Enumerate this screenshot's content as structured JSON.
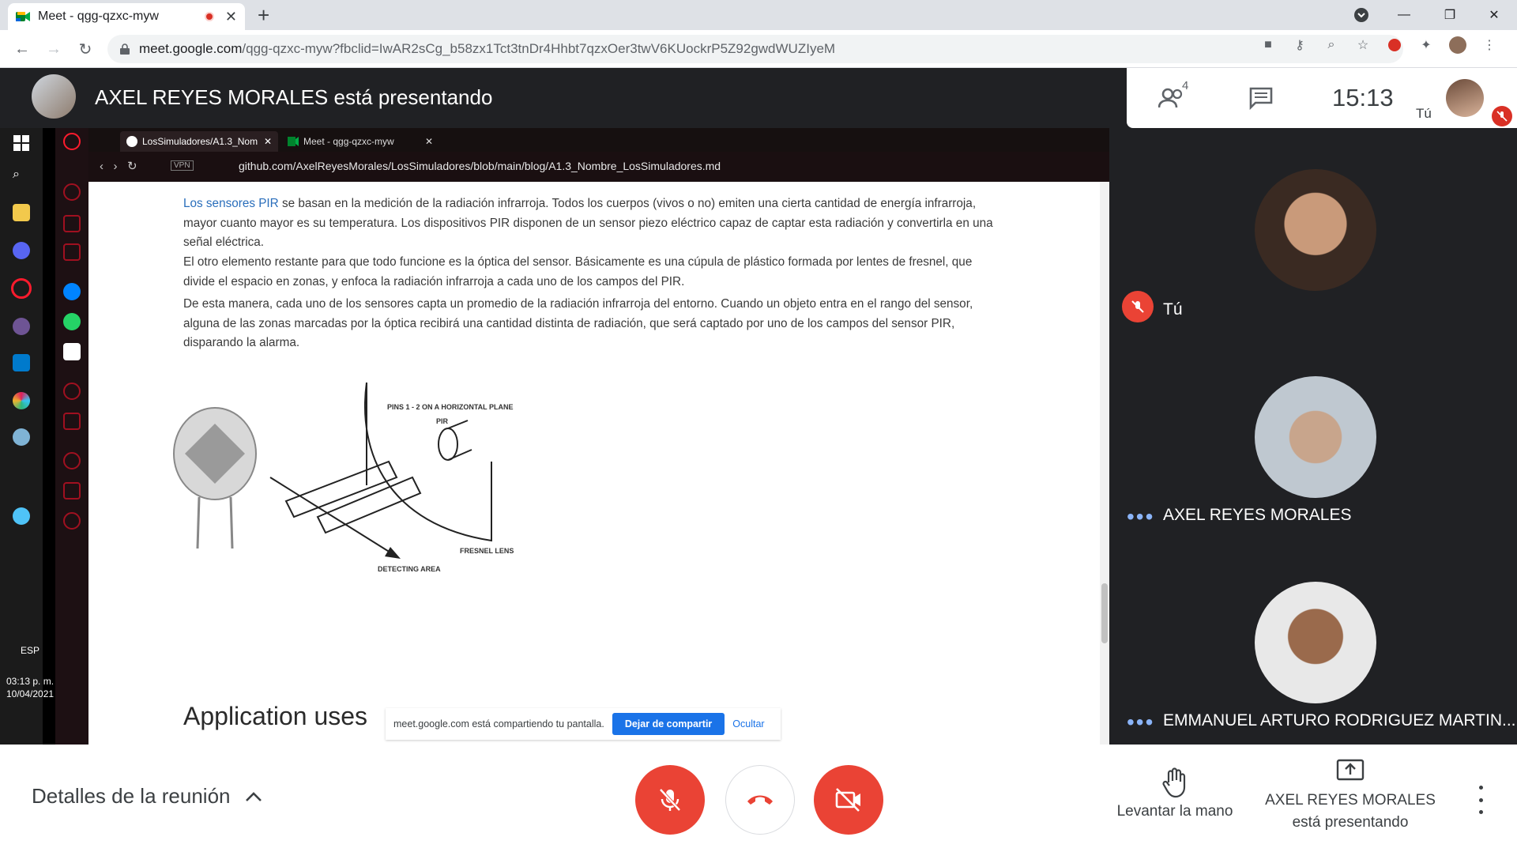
{
  "browser": {
    "tab_title": "Meet - qgg-qzxc-myw",
    "url_host": "meet.google.com",
    "url_path": "/qgg-qzxc-myw?fbclid=IwAR2sCg_b58zx1Tct3tnDr4Hhbt7qzxOer3twV6KUockrP5Z92gwdWUZIyeM"
  },
  "meet_header": {
    "presenting_title": "AXEL REYES MORALES está presentando",
    "participant_count": "4",
    "clock": "15:13",
    "self_label": "Tú"
  },
  "shared_screen": {
    "inner_tabs": [
      "LosSimuladores/A1.3_Nom",
      "Meet - qgg-qzxc-myw"
    ],
    "inner_url": "github.com/AxelReyesMorales/LosSimuladores/blob/main/blog/A1.3_Nombre_LosSimuladores.md",
    "para1_link": "Los sensores PIR",
    "para1_rest": " se basan en la medición de la radiación infrarroja. Todos los cuerpos (vivos o no) emiten una cierta cantidad de energía infrarroja, mayor cuanto mayor es su temperatura. Los dispositivos PIR disponen de un sensor piezo eléctrico capaz de captar esta radiación y convertirla en una señal eléctrica.",
    "para2": "El otro elemento restante para que todo funcione es la óptica del sensor. Básicamente es una cúpula de plástico formada por lentes de fresnel, que divide el espacio en zonas, y enfoca la radiación infrarroja a cada uno de los campos del PIR.",
    "para3": "De esta manera, cada uno de los sensores capta un promedio de la radiación infrarroja del entorno. Cuando un objeto entra en el rango del sensor, alguna de las zonas marcadas por la óptica recibirá una cantidad distinta de radiación, que será captado por uno de los campos del sensor PIR, disparando la alarma.",
    "diagram_labels": {
      "pins": "PINS 1 - 2 ON A HORIZONTAL PLANE",
      "pir": "PIR",
      "fresnel": "FRESNEL LENS",
      "detecting": "DETECTING AREA"
    },
    "heading": "Application uses",
    "share_notice": "meet.google.com está compartiendo tu pantalla.",
    "stop_share": "Dejar de compartir",
    "hide": "Ocultar",
    "taskbar_lang": "ESP",
    "taskbar_time": "03:13 p. m.",
    "taskbar_date": "10/04/2021"
  },
  "participants": [
    {
      "name": "Tú",
      "muted": true
    },
    {
      "name": "AXEL REYES MORALES",
      "muted": false
    },
    {
      "name": "EMMANUEL ARTURO RODRIGUEZ MARTIN...",
      "muted": false
    }
  ],
  "bottom": {
    "meeting_details": "Detalles de la reunión",
    "raise_hand": "Levantar la mano",
    "presenting_line1": "AXEL REYES MORALES",
    "presenting_line2": "está presentando"
  },
  "colors": {
    "meet_red": "#ea4335",
    "meet_dark": "#202124",
    "tile_bg": "#3c4043",
    "link_blue": "#2a6ebb"
  }
}
